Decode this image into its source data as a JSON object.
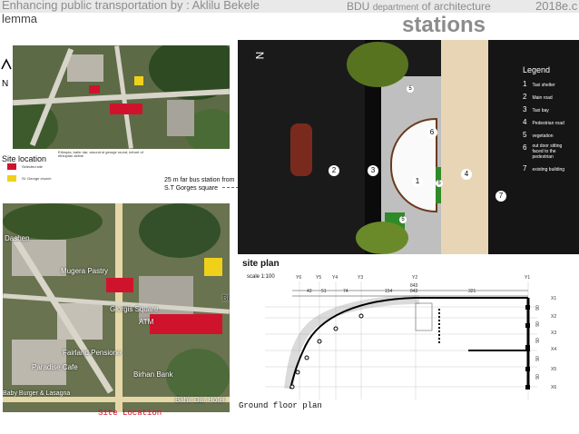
{
  "header": {
    "title": "Enhancing public transportation   by : Aklilu Bekele",
    "title_cont": "lemma",
    "dept_prefix": "BDU",
    "dept_small": "department",
    "dept_suffix": "of architecture",
    "year": "2018e.c",
    "stations": "stations"
  },
  "map_top": {
    "compass": "N",
    "legend_title": "Site location",
    "legend_items": [
      {
        "color": "#d0132c",
        "label": "Selected site"
      },
      {
        "color": "#f0d11a",
        "label": "St. George church"
      }
    ],
    "caption": "Ethiopia, bahir dar, around st george round, infront of ethiopian airline"
  },
  "note": "25 m far bus station from S.T Gorges square",
  "map_bottom": {
    "labels": [
      "Dashen",
      "Mugera Pastry",
      "Giorgis Square",
      "ATM",
      "Fairland Pensione",
      "Paradise Cafe",
      "Birhan Bank",
      "Baby Burger & Lasagna",
      "Bahir Dar Hotel",
      "Bli"
    ],
    "caption": "Site Location"
  },
  "site_plan": {
    "compass": "N",
    "legend_title": "Legend",
    "legend_items": [
      {
        "num": "1",
        "label": "Taxi shelter"
      },
      {
        "num": "2",
        "label": "Main road"
      },
      {
        "num": "3",
        "label": "Taxi bay"
      },
      {
        "num": "4",
        "label": "Pedestrian road"
      },
      {
        "num": "5",
        "label": "vegetation"
      },
      {
        "num": "6",
        "label": "out door sitting faced to the pedestrian"
      },
      {
        "num": "7",
        "label": "existing building"
      }
    ],
    "markers": [
      "1",
      "2",
      "3",
      "4",
      "5",
      "6",
      "7",
      "5",
      "5"
    ],
    "title": "site plan",
    "scale": "scale 1:100"
  },
  "ground_floor": {
    "title": "Ground floor plan",
    "top_axes": [
      "Y6",
      "Y5",
      "Y4",
      "Y3",
      "Y2",
      "Y1"
    ],
    "dims": [
      "43",
      "51",
      "74",
      "154",
      "843",
      "843",
      "321"
    ],
    "side_axes": [
      "X1",
      "X2",
      "X3",
      "X4",
      "X5",
      "X6"
    ],
    "side_dims": [
      "90",
      "90",
      "90",
      "90",
      "90"
    ]
  }
}
